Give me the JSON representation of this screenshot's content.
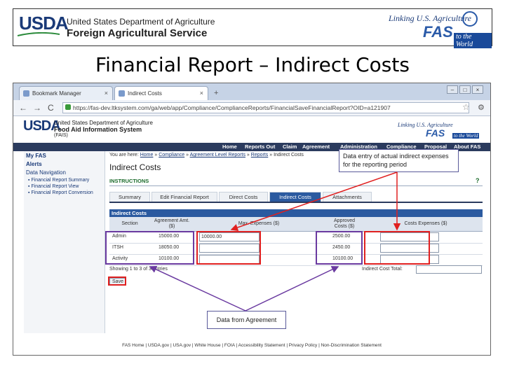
{
  "banner": {
    "usda": "USDA",
    "dept": "United States Department of Agriculture",
    "agency": "Foreign Agricultural Service",
    "linking": "Linking U.S. Agriculture",
    "fas": "FAS",
    "to_world": "to the World"
  },
  "slide_title": "Financial Report – Indirect Costs",
  "browser": {
    "tabs": [
      {
        "label": "Bookmark Manager",
        "close": "×"
      },
      {
        "label": "Indirect Costs",
        "close": "×"
      }
    ],
    "new_tab": "+",
    "window_buttons": [
      "–",
      "□",
      "×"
    ],
    "nav": {
      "back": "←",
      "forward": "→",
      "reload": "C"
    },
    "url": "https://fas-dev.ltksystem.com/ga/web/app/Compliance/ComplianceReports/FinancialSaveFinancialReport?OID=a121907",
    "star": "☆",
    "wrench": "⚙"
  },
  "site": {
    "usda": "USDA",
    "dept": "United States Department of Agriculture",
    "system": "Food Aid Information System",
    "sub": "(FAIS)",
    "linking": "Linking U.S. Agriculture",
    "fas": "FAS",
    "to_world": "to the World",
    "nav": [
      "Home",
      "Reports Out",
      "Claim",
      "Agreement",
      "Administration",
      "Compliance",
      "Proposal",
      "About FAS"
    ]
  },
  "sidebar": {
    "myfas": "My FAS",
    "alerts": "Alerts",
    "data_nav": "Data Navigation",
    "links": [
      "Financial Report Summary",
      "Financial Report View",
      "Financial Report Conversion"
    ]
  },
  "breadcrumb": {
    "prefix": "You are here:",
    "items": [
      "Home",
      "Compliance",
      "Agreement Level Reports",
      "Reports",
      "Indirect Costs"
    ]
  },
  "page_heading": "Indirect Costs",
  "instructions": {
    "label": "INSTRUCTIONS",
    "help": "?"
  },
  "subtabs": [
    "Summary",
    "Edit Financial Report",
    "Direct Costs",
    "Indirect Costs",
    "Attachments"
  ],
  "table": {
    "title": "Indirect Costs",
    "headers": [
      "Section",
      "Agreement Amt.\n($)",
      "Max. Expenses ($)",
      "Approved\nCosts ($)",
      "Costs Expenses ($)"
    ],
    "rows": [
      {
        "section": "Admin",
        "agreement_amt": "15000.00",
        "max_expenses": "10000.00",
        "approved": "2500.00",
        "costs_expenses": ""
      },
      {
        "section": "ITSH",
        "agreement_amt": "18050.00",
        "max_expenses": "",
        "approved": "2450.00",
        "costs_expenses": ""
      },
      {
        "section": "Activity",
        "agreement_amt": "10100.00",
        "max_expenses": "",
        "approved": "10100.00",
        "costs_expenses": ""
      }
    ],
    "showing": "Showing 1 to 3 of 3 entries",
    "total_label": "Indirect Cost Total:",
    "save": "Save"
  },
  "footer": "FAS Home | USDA.gov | USA.gov | White House | FOIA | Accessibility Statement | Privacy Policy | Non-Discrimination Statement",
  "callouts": {
    "actual": "Data entry of actual indirect expenses for the reporting period",
    "agreement": "Data from Agreement"
  },
  "colors": {
    "red_highlight": "#e02020",
    "purple_highlight": "#6a3aa0",
    "nav_bg": "#2b3b5e",
    "accent": "#2b5aa0"
  }
}
